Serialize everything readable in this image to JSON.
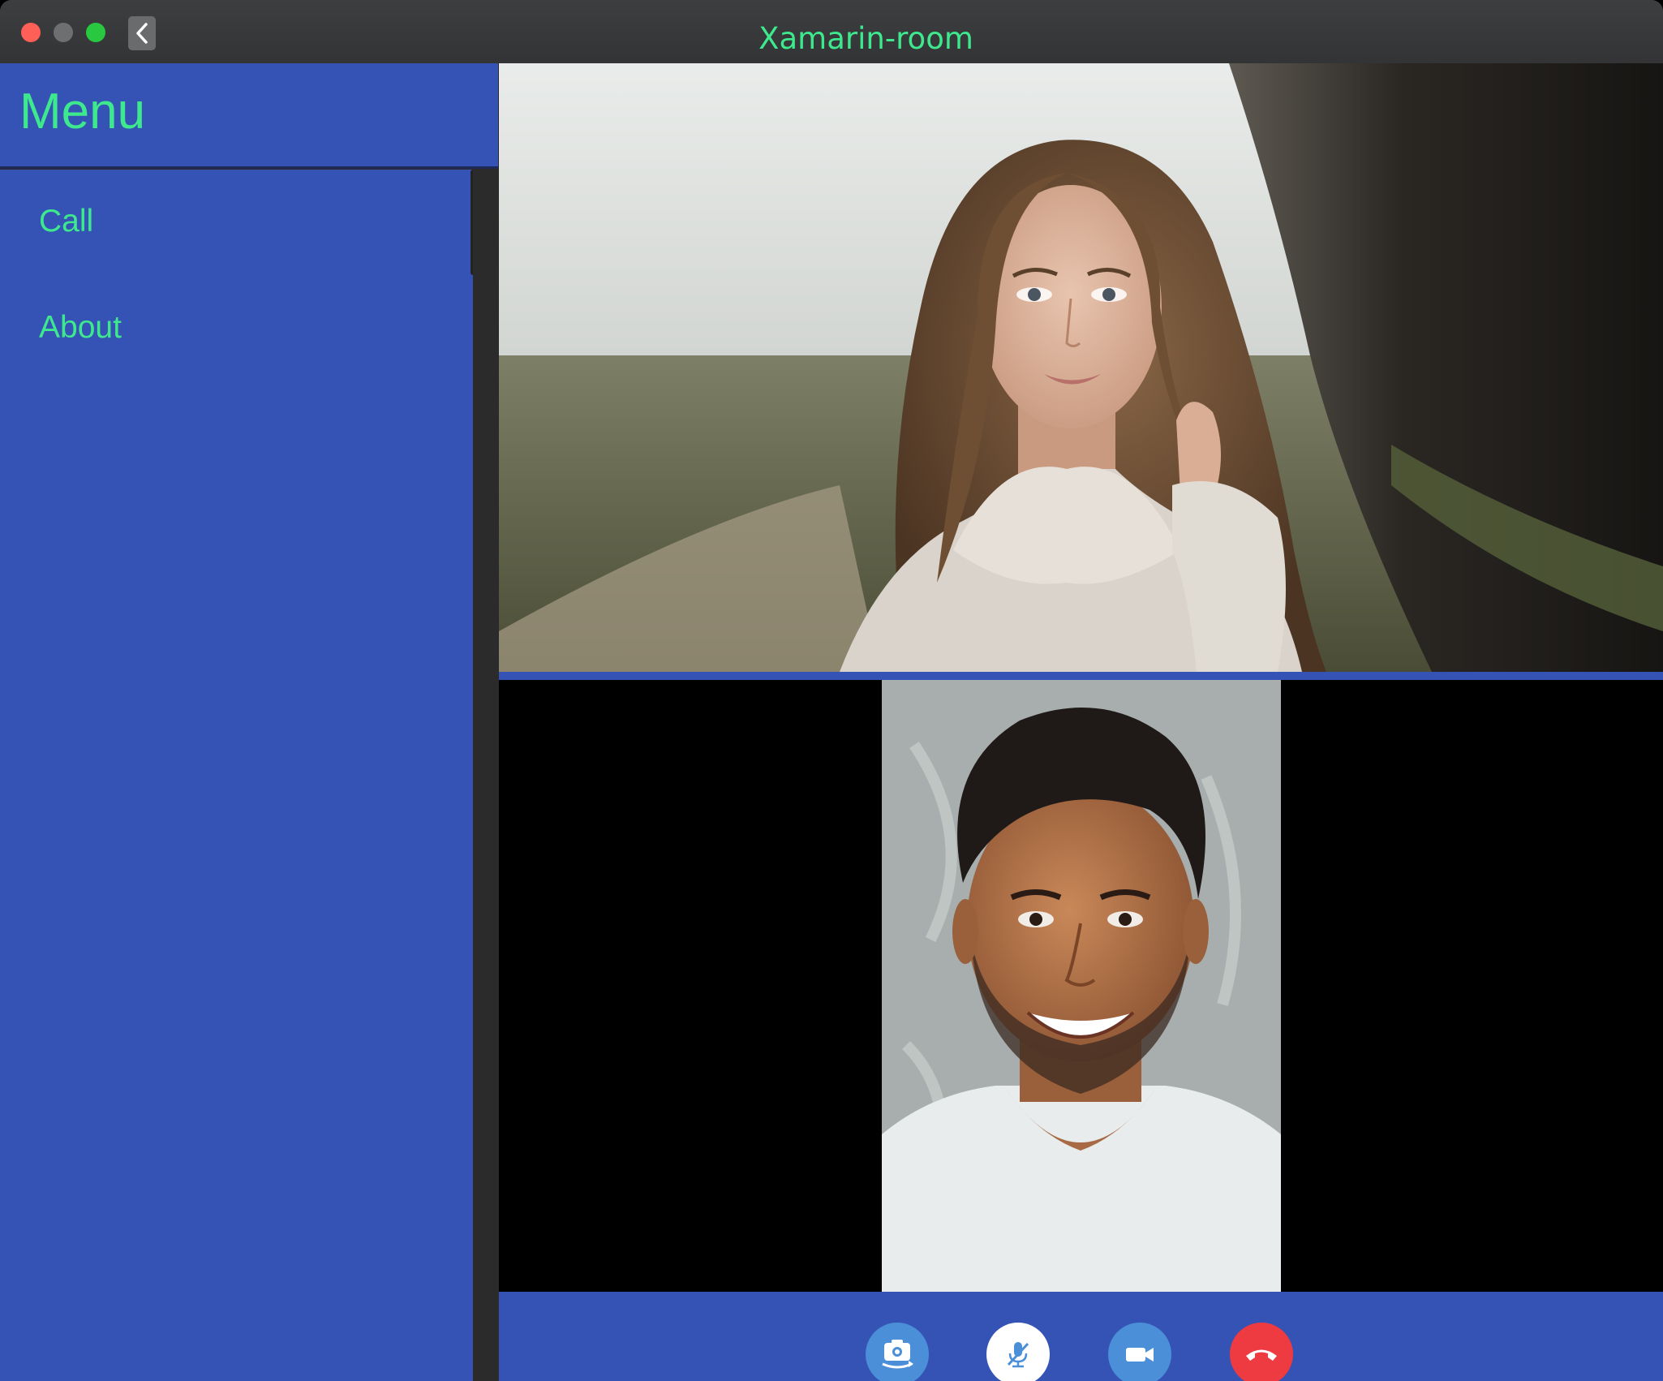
{
  "window": {
    "title": "Xamarin-room"
  },
  "sidebar": {
    "header": "Menu",
    "items": [
      {
        "label": "Call"
      },
      {
        "label": "About"
      }
    ]
  },
  "video": {
    "remote_participant": "remote-participant-woman",
    "local_participant": "local-participant-man"
  },
  "controls": [
    {
      "icon": "switch-camera-icon"
    },
    {
      "icon": "mute-microphone-icon"
    },
    {
      "icon": "video-camera-icon"
    },
    {
      "icon": "hang-up-icon"
    }
  ],
  "colors": {
    "accent_blue": "#3553b5",
    "text_green": "#3ee88d",
    "hangup_red": "#ee3a41",
    "control_blue": "#4a8fd8"
  }
}
